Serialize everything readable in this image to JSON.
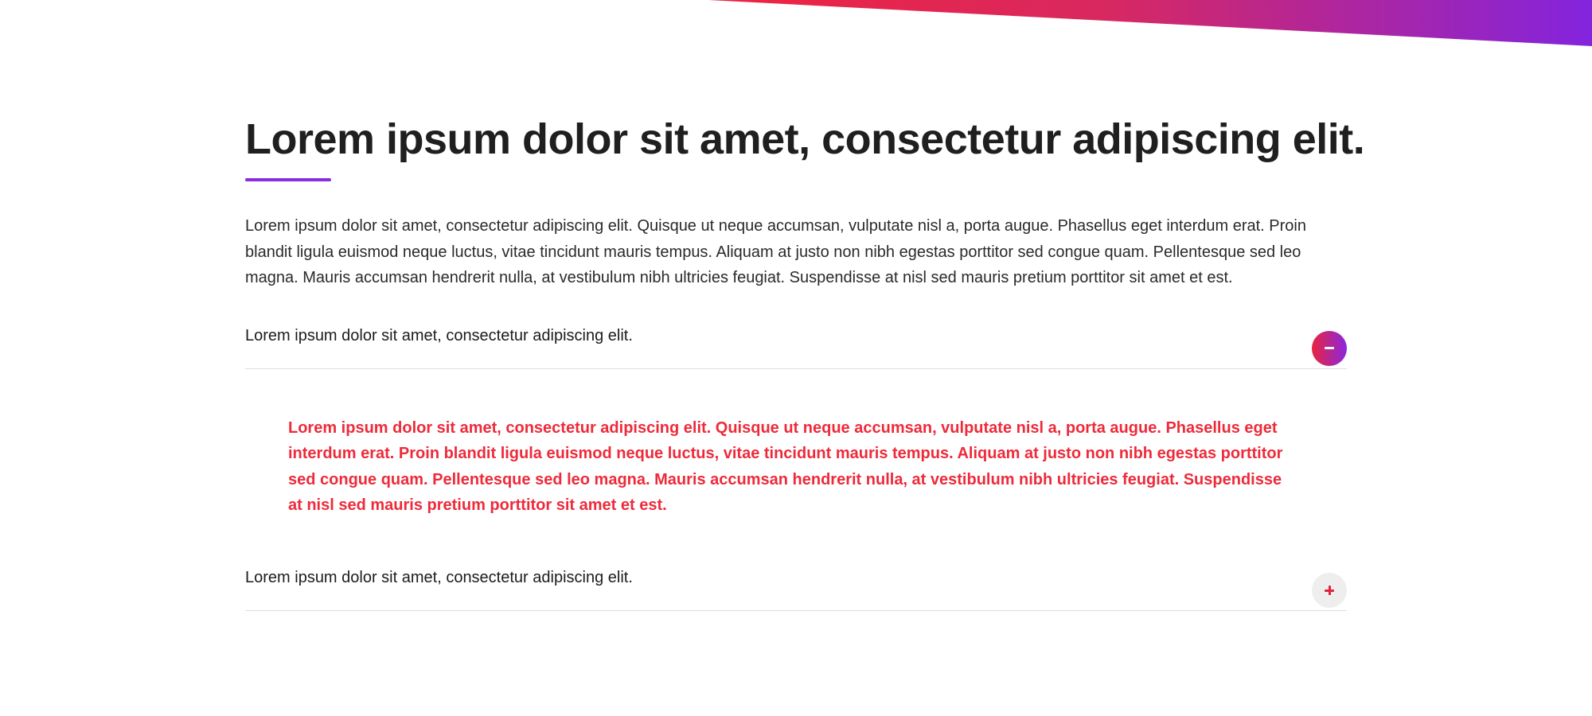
{
  "colors": {
    "accent_purple": "#8a2be2",
    "accent_red": "#e8233f",
    "answer_text": "#ee2a3a",
    "gradient_start": "#e8233f",
    "gradient_end": "#8b27e0"
  },
  "page": {
    "title": "Lorem ipsum dolor sit amet, consectetur adipiscing elit.",
    "intro": "Lorem ipsum dolor sit amet, consectetur adipiscing elit. Quisque ut neque accumsan, vulputate nisl a, porta augue. Phasellus eget interdum erat. Proin blandit ligula euismod neque luctus, vitae tincidunt mauris tempus. Aliquam at justo non nibh egestas porttitor sed congue quam. Pellentesque sed leo magna. Mauris accumsan hendrerit nulla, at vestibulum nibh ultricies feugiat. Suspendisse at nisl sed mauris pretium porttitor sit amet et est."
  },
  "faq": {
    "items": [
      {
        "question": "Lorem ipsum dolor sit amet, consectetur adipiscing elit.",
        "answer": "Lorem ipsum dolor sit amet, consectetur adipiscing elit. Quisque ut neque accumsan, vulputate nisl a, porta augue. Phasellus eget interdum erat. Proin blandit ligula euismod neque luctus, vitae tincidunt mauris tempus. Aliquam at justo non nibh egestas porttitor sed congue quam. Pellentesque sed leo magna. Mauris accumsan hendrerit nulla, at vestibulum nibh ultricies feugiat. Suspendisse at nisl sed mauris pretium porttitor sit amet et est.",
        "expanded": true,
        "toggle_icon": "minus-icon"
      },
      {
        "question": "Lorem ipsum dolor sit amet, consectetur adipiscing elit.",
        "expanded": false,
        "toggle_icon": "plus-icon"
      }
    ]
  }
}
